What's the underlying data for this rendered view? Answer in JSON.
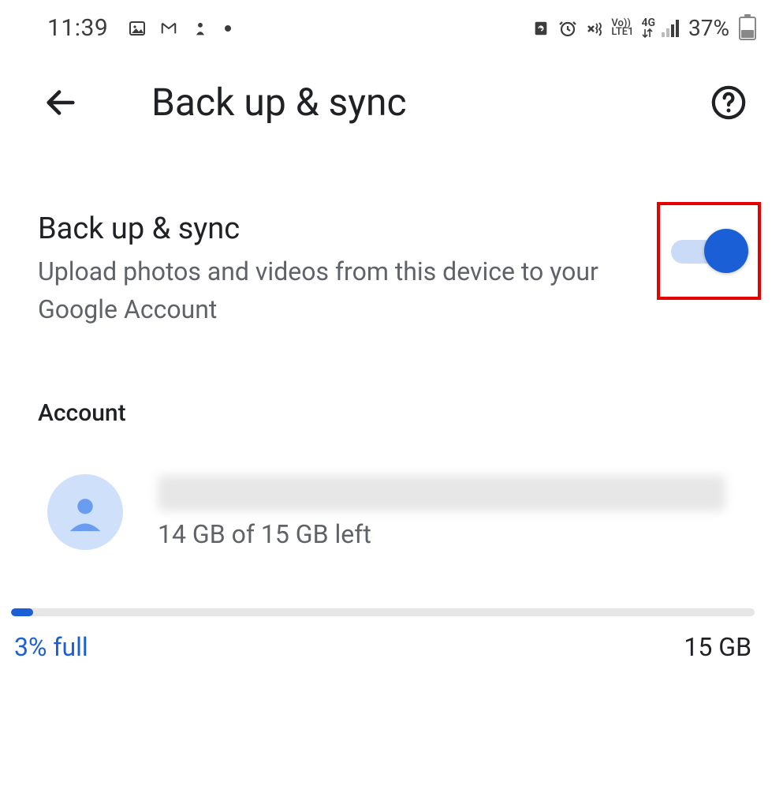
{
  "status": {
    "time": "11:39",
    "battery_percent": "37%",
    "lte_top": "Vo))",
    "lte_bottom": "LTE1",
    "network": "4G"
  },
  "header": {
    "title": "Back up & sync"
  },
  "setting": {
    "title": "Back up & sync",
    "description": "Upload photos and videos from this device to your Google Account",
    "enabled": true
  },
  "account": {
    "section_label": "Account",
    "storage_text": "14 GB of 15 GB left"
  },
  "storage": {
    "percent_full_label": "3% full",
    "total_label": "15 GB",
    "percent_value": 3
  }
}
